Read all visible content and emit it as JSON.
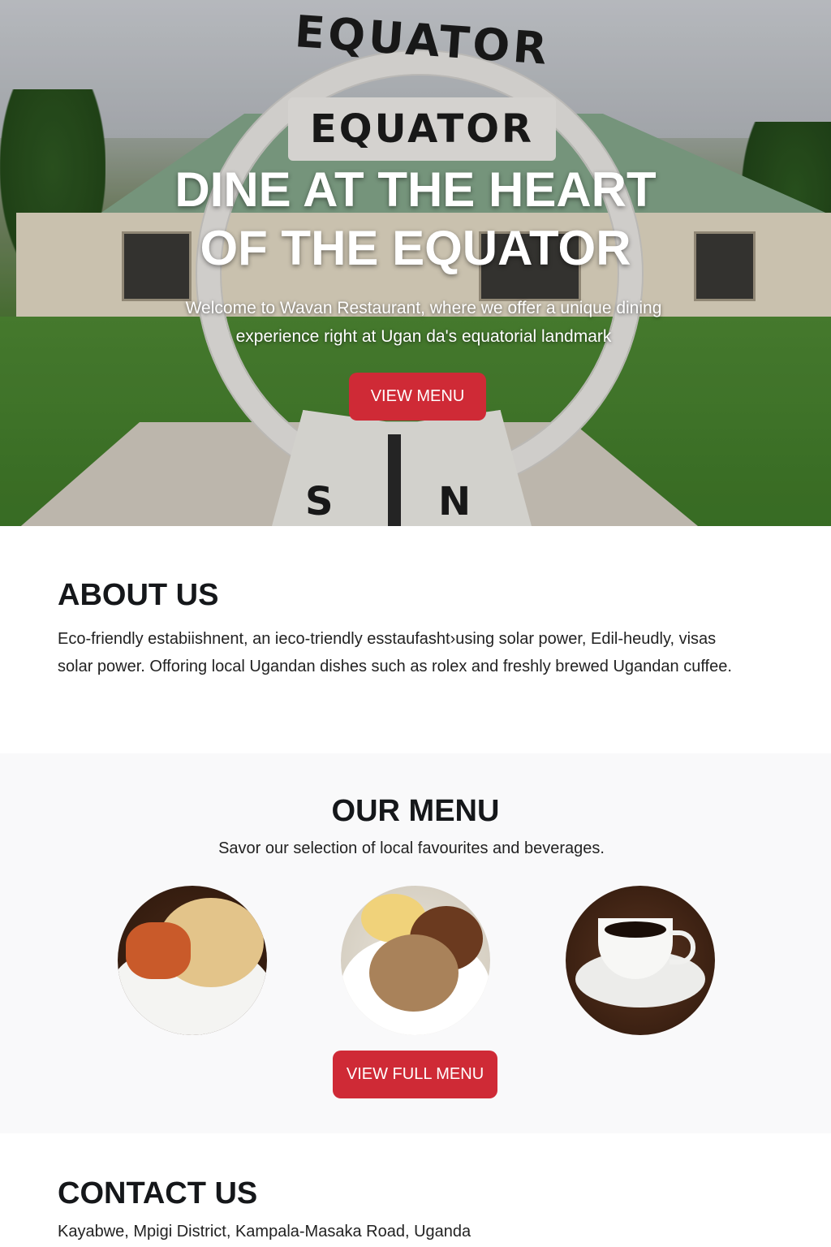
{
  "hero": {
    "arch_top_text": "EQUATOR",
    "banner_text": "EQUATOR",
    "base_letter_left": "S",
    "base_letter_right": "N",
    "title_line1": "DINE AT THE HEART",
    "title_line2": "OF THE EQUATOR",
    "subtitle": "Welcome to Wavan Restaurant, where we offer a unique dining experience right at Ugan da's equatorial landmark",
    "button_label": "VIEW MENU"
  },
  "about": {
    "heading": "ABOUT US",
    "body": "Eco-friendly estabiishnent, an ieco-triendly esstaufasht›using solar power, Edil-heudly, visas solar power. Offoring local Ugandan dishes such as rolex  and freshly brewed Ugandan cuffee."
  },
  "menu": {
    "heading": "OUR MENU",
    "subtitle": "Savor our selection of local favourites and beverages.",
    "button_label": "VIEW FULL MENU"
  },
  "contact": {
    "heading": "CONTACT US",
    "address": "Kayabwe, Mpigi District,  Kampala-Masaka Road, Uganda"
  },
  "colors": {
    "accent": "#cf2a36",
    "heading": "#15171a",
    "menu_bg": "#f9f9fa"
  }
}
